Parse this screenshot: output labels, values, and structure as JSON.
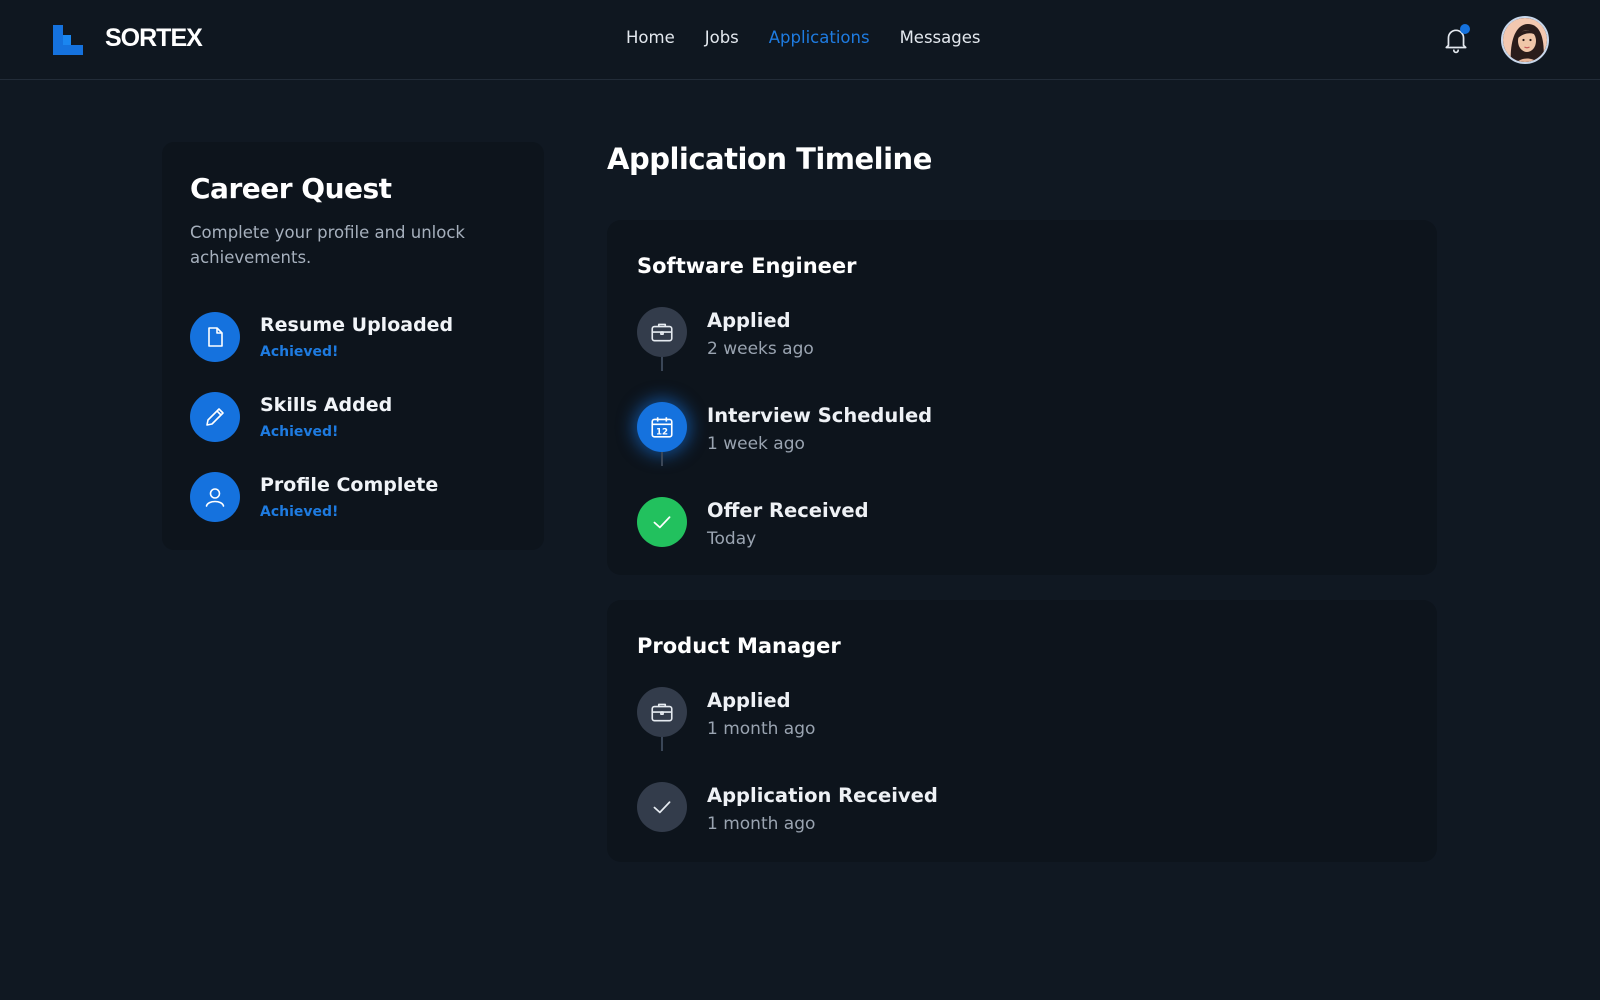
{
  "header": {
    "brand": "SORTEX",
    "nav": [
      "Home",
      "Jobs",
      "Applications",
      "Messages"
    ],
    "active_nav": "Applications",
    "accent_color": "#1572de"
  },
  "quest": {
    "title": "Career Quest",
    "description": "Complete your profile and unlock achievements.",
    "achievements": [
      {
        "title": "Resume Uploaded",
        "status": "Achieved!",
        "icon": "document-icon"
      },
      {
        "title": "Skills Added",
        "status": "Achieved!",
        "icon": "pencil-icon"
      },
      {
        "title": "Profile Complete",
        "status": "Achieved!",
        "icon": "user-icon"
      }
    ]
  },
  "timeline": {
    "heading": "Application Timeline",
    "jobs": [
      {
        "title": "Software Engineer",
        "steps": [
          {
            "label": "Applied",
            "time": "2 weeks ago",
            "icon": "briefcase-icon",
            "state": "done"
          },
          {
            "label": "Interview Scheduled",
            "time": "1 week ago",
            "icon": "calendar-icon",
            "state": "current"
          },
          {
            "label": "Offer Received",
            "time": "Today",
            "icon": "check-icon",
            "state": "success"
          }
        ]
      },
      {
        "title": "Product Manager",
        "steps": [
          {
            "label": "Applied",
            "time": "1 month ago",
            "icon": "briefcase-icon",
            "state": "done"
          },
          {
            "label": "Application Received",
            "time": "1 month ago",
            "icon": "check-icon",
            "state": "done"
          }
        ]
      }
    ]
  }
}
